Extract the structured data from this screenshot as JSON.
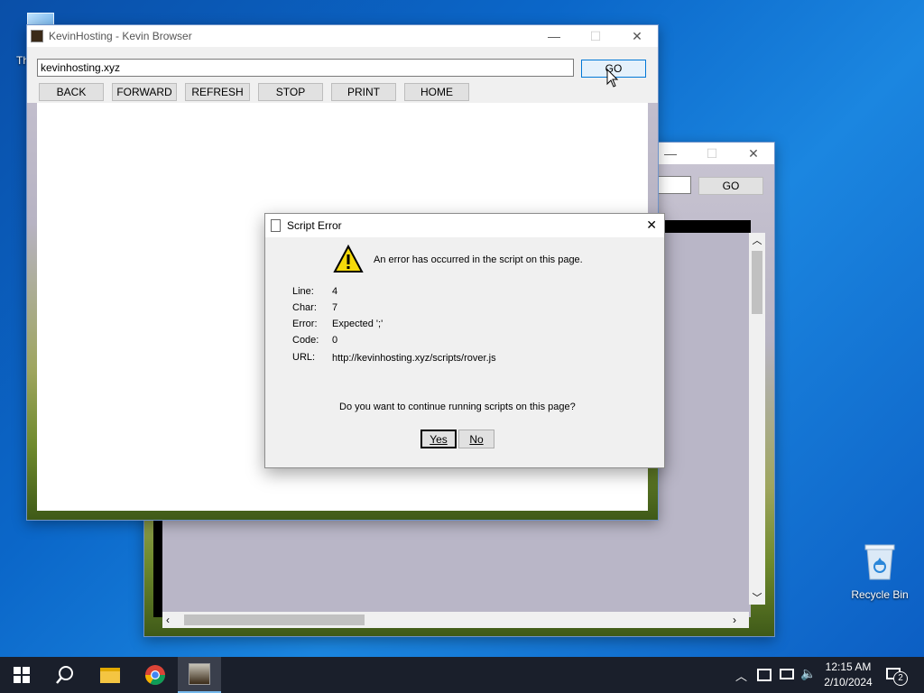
{
  "desktop": {
    "recycle_bin_label": "Recycle Bin",
    "partial_icon_label": "Th"
  },
  "back_window": {
    "go_label": "GO"
  },
  "browser": {
    "title": "KevinHosting - Kevin Browser",
    "address_value": "kevinhosting.xyz",
    "go_label": "GO",
    "nav": {
      "back": "BACK",
      "forward": "FORWARD",
      "refresh": "REFRESH",
      "stop": "STOP",
      "print": "PRINT",
      "home": "HOME"
    }
  },
  "dialog": {
    "title": "Script Error",
    "message": "An error has occurred in the script on this page.",
    "fields": {
      "line_label": "Line:",
      "line_value": "4",
      "char_label": "Char:",
      "char_value": "7",
      "error_label": "Error:",
      "error_value": "Expected ';'",
      "code_label": "Code:",
      "code_value": "0",
      "url_label": "URL:",
      "url_value": "http://kevinhosting.xyz/scripts/rover.js"
    },
    "question": "Do you want to continue running scripts on this page?",
    "yes_label": "Yes",
    "no_label": "No"
  },
  "taskbar": {
    "time": "12:15 AM",
    "date": "2/10/2024",
    "notification_count": "2"
  },
  "colors": {
    "accent": "#0078d7",
    "taskbar": "#1a1f2b",
    "warning": "#f5d90a"
  }
}
